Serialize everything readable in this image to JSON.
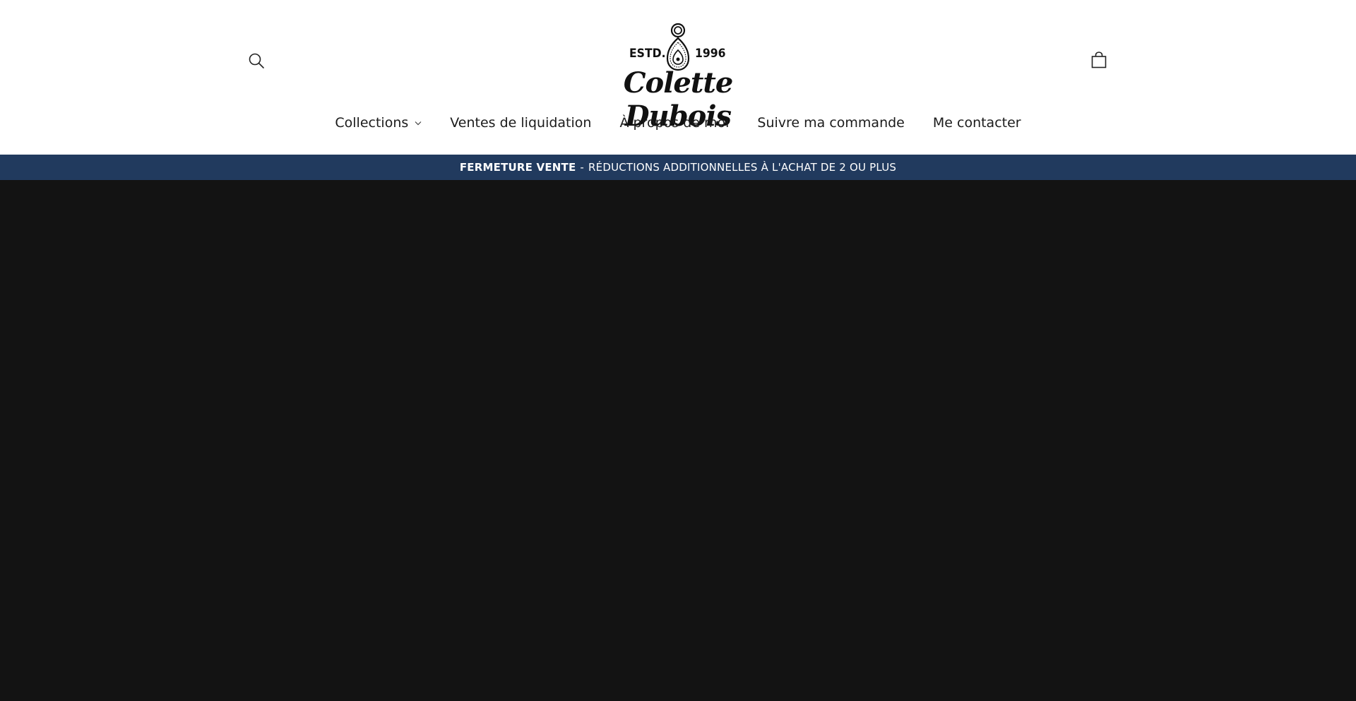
{
  "header": {
    "logo": {
      "estd_label": "ESTD.",
      "year": "1996",
      "brand_name": "Colette Dubois"
    },
    "search_icon": "search-icon",
    "cart_icon": "shopping-bag-icon"
  },
  "nav": {
    "items": [
      {
        "label": "Collections",
        "has_dropdown": true
      },
      {
        "label": "Ventes de liquidation",
        "has_dropdown": false
      },
      {
        "label": "À propos de moi",
        "has_dropdown": false
      },
      {
        "label": "Suivre ma commande",
        "has_dropdown": false
      },
      {
        "label": "Me contacter",
        "has_dropdown": false
      }
    ]
  },
  "announcement": {
    "highlight": "FERMETURE VENTE",
    "separator": "-",
    "message": "RÉDUCTIONS ADDITIONNELLES À L'ACHAT DE 2 OU PLUS"
  },
  "colors": {
    "header_bg": "#ffffff",
    "announcement_bg": "#213a5e",
    "hero_bg": "#131313"
  }
}
